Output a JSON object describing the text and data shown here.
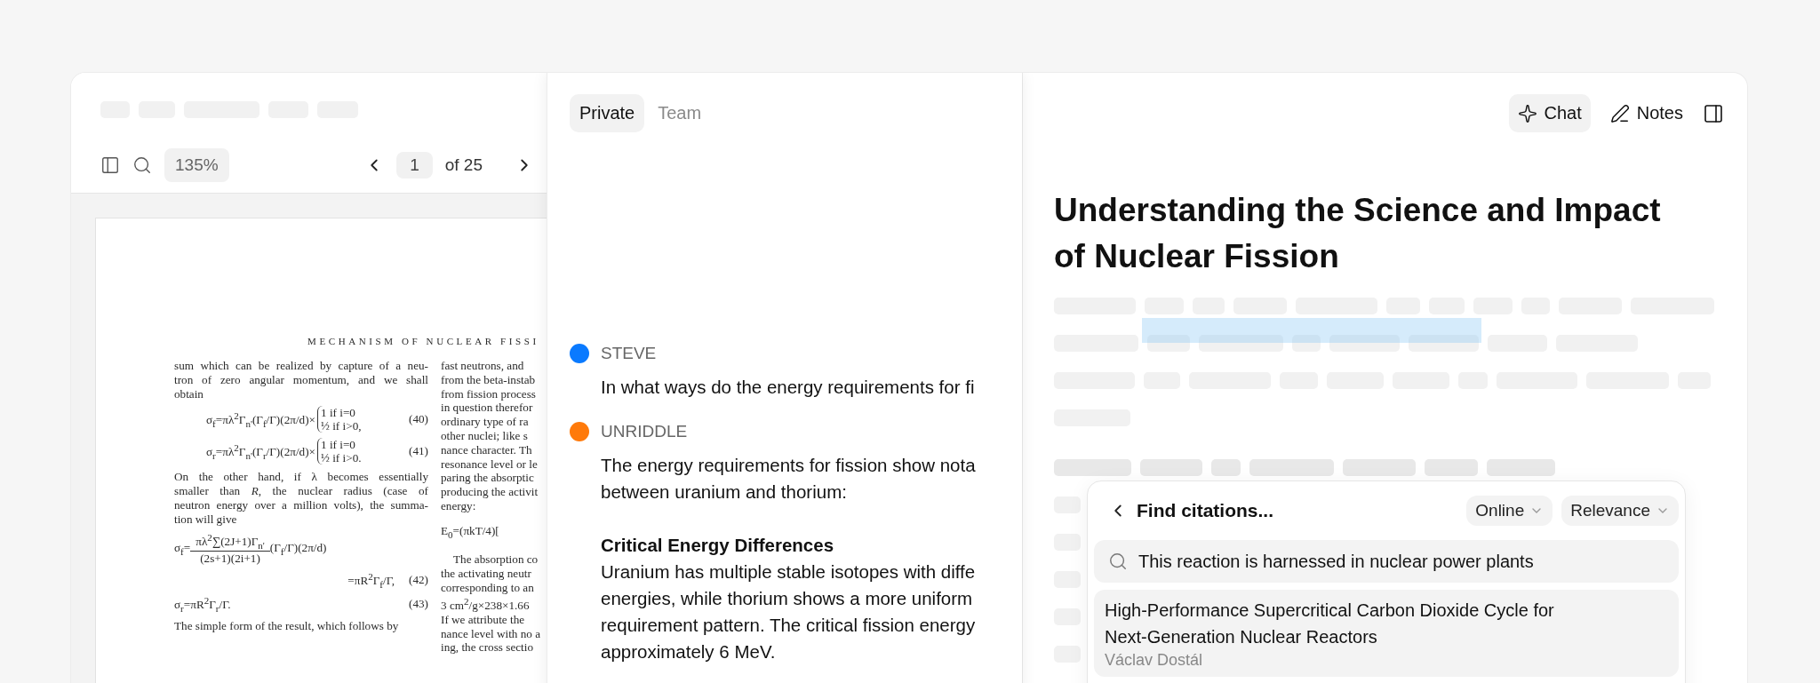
{
  "pdf_toolbar": {
    "zoom": "135%",
    "page": "1",
    "page_total": "of 25"
  },
  "pdf_page": {
    "header": "MECHANISM OF NUCLEAR FISSI",
    "left_column": [
      {
        "kind": "para",
        "lines": [
          "sum which can be realized by capture of a neu-",
          "tron of zero angular momentum, and we shall",
          "obtain"
        ]
      },
      {
        "kind": "cases",
        "lhs": "σ$_{f}$=πλ$^{2}$Γ$_{n'}$(Γ$_{f}$/Γ)(2π/d)×",
        "cases": [
          "1 if i=0",
          "½ if i>0,"
        ],
        "number": "(40)"
      },
      {
        "kind": "cases",
        "lhs": "σ$_{r}$=πλ$^{2}$Γ$_{n'}$(Γ$_{r}$/Γ)(2π/d)×",
        "cases": [
          "1 if i=0",
          "½ if i>0."
        ],
        "number": "(41)"
      },
      {
        "kind": "para",
        "lines": [
          "On the other hand, if λ becomes essentially",
          "smaller than *R*, the nuclear radius (case of",
          "neutron energy over a million volts), the summa-",
          "tion will give"
        ]
      },
      {
        "kind": "fraction",
        "lhs": "σ$_{f}$=",
        "numerator": "πλ$^{2}$∑(2J+1)Γ$_{n'}$",
        "denominator": "(2s+1)(2i+1)",
        "tail": "(Γ$_{f}$/Γ)(2π/d)"
      },
      {
        "kind": "continuation",
        "text": "=πR$^{2}$Γ$_{f}$/Γ,",
        "number": "(42)"
      },
      {
        "kind": "equation",
        "text": "σ$_{r}$=πR$^{2}$Γ$_{r}$/Γ.",
        "number": "(43)"
      },
      {
        "kind": "para",
        "lines": [
          "The simple form of the result, which follows by"
        ]
      }
    ],
    "right_column": [
      {
        "kind": "line",
        "text": "fast neutrons, and"
      },
      {
        "kind": "line",
        "text": "from the beta-instab"
      },
      {
        "kind": "line",
        "text": "from fission process"
      },
      {
        "kind": "line",
        "text": "in question therefor"
      },
      {
        "kind": "line",
        "text": "ordinary type of ra"
      },
      {
        "kind": "line",
        "text": "other nuclei; like s"
      },
      {
        "kind": "line",
        "text": "nance character. Th"
      },
      {
        "kind": "line",
        "text": "resonance level or le"
      },
      {
        "kind": "line",
        "text": "paring the absorptic"
      },
      {
        "kind": "line",
        "text": "producing the activit"
      },
      {
        "kind": "line",
        "text": "energy:"
      },
      {
        "kind": "formula",
        "text": "E$_{0}$=(πkT/4)["
      },
      {
        "kind": "indent",
        "text": "The absorption co"
      },
      {
        "kind": "line",
        "text": "the activating neutr"
      },
      {
        "kind": "line",
        "text": "corresponding to an"
      },
      {
        "kind": "line",
        "text": "3 cm$^{2}$/g×238×1.66"
      },
      {
        "kind": "line",
        "text": "If we attribute the"
      },
      {
        "kind": "line",
        "text": "nance level with no a"
      },
      {
        "kind": "line",
        "text": "ing, the cross sectio"
      }
    ]
  },
  "chat": {
    "tabs": [
      {
        "label": "Private",
        "selected": true
      },
      {
        "label": "Team",
        "selected": false
      }
    ],
    "messages": [
      {
        "author": "STEVE",
        "color": "#0a7aff",
        "blocks": [
          {
            "kind": "text",
            "lines": [
              "In what ways do the energy requirements for fi"
            ]
          }
        ]
      },
      {
        "author": "UNRIDDLE",
        "color": "#ff7a0a",
        "blocks": [
          {
            "kind": "text",
            "lines": [
              "The energy requirements for fission show nota",
              "between uranium and thorium:"
            ]
          },
          {
            "kind": "heading",
            "lines": [
              "Critical Energy Differences"
            ]
          },
          {
            "kind": "text",
            "lines": [
              "Uranium has multiple stable isotopes with diffe",
              "energies, while thorium shows a more uniform",
              "requirement pattern. The critical fission energy",
              "approximately 6 MeV."
            ]
          }
        ]
      }
    ]
  },
  "notes": {
    "header_buttons": [
      {
        "label": "Chat",
        "kind": "chat",
        "selected": true
      },
      {
        "label": "Notes",
        "kind": "notes",
        "selected": false
      }
    ],
    "title": "Understanding the Science and Impact of Nuclear Fission",
    "citation_finder": {
      "title": "Find citations...",
      "filters": [
        "Online",
        "Relevance"
      ],
      "search": {
        "value": "This reaction is harnessed in nuclear power plants"
      },
      "results": [
        {
          "title": "High-Performance Supercritical Carbon Dioxide Cycle for Next-Generation Nuclear Reactors",
          "author": "Václav Dostál"
        }
      ]
    }
  }
}
